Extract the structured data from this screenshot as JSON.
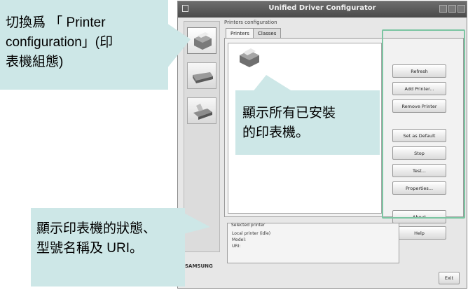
{
  "window": {
    "title": "Unified Driver Configurator"
  },
  "group_label": "Printers configuration",
  "tabs": [
    {
      "label": "Printers"
    },
    {
      "label": "Classes"
    }
  ],
  "buttons": [
    {
      "label": "Refresh"
    },
    {
      "label": "Add Printer..."
    },
    {
      "label": "Remove Printer"
    },
    {
      "label": "Set as Default"
    },
    {
      "label": "Stop"
    },
    {
      "label": "Test..."
    },
    {
      "label": "Properties..."
    },
    {
      "label": "About"
    },
    {
      "label": "Help"
    }
  ],
  "selected_printer": {
    "label": "Selected printer",
    "lines": [
      "Local printer (idle)",
      "Model:",
      "URI:"
    ]
  },
  "exit_label": "Exit",
  "brand": "SAMSUNG",
  "callouts": {
    "top_left_line1": "切換爲 「 Printer",
    "top_left_line2": "configuration」(印",
    "top_left_line3": "表機組態)",
    "middle_line1": "顯示所有已安裝",
    "middle_line2": "的印表機。",
    "bottom_line1": "顯示印表機的狀態、",
    "bottom_line2": "型號名稱及 URI。"
  },
  "colors": {
    "callout_bg": "#cde7e7",
    "highlight_frame": "#7cc5a2"
  }
}
